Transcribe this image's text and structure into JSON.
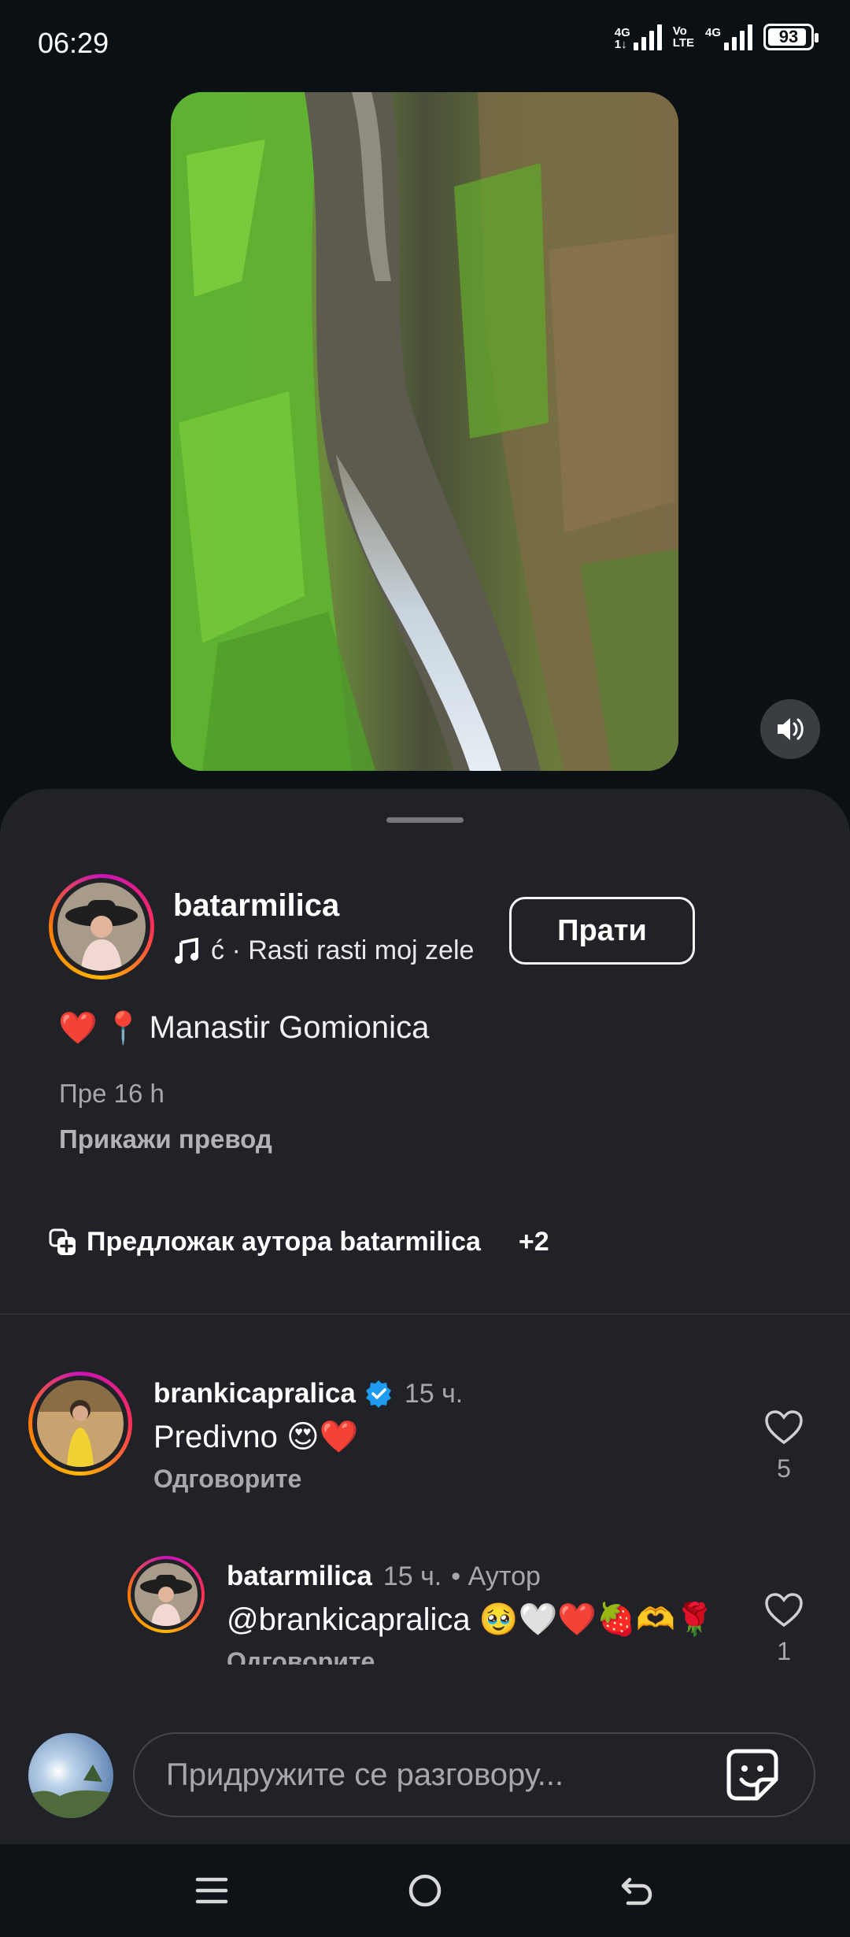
{
  "status_bar": {
    "time": "06:29",
    "net1_top": "4G",
    "net1_bottom": "1↓",
    "net2_top": "Vo",
    "net2_bottom": "LTE",
    "net3_top": "4G",
    "battery_percent": "93",
    "battery_level": 0.93
  },
  "reel": {
    "sound_icon": "speaker-icon"
  },
  "sheet": {
    "author": {
      "username": "batarmilica",
      "audio": "ć · Rasti rasti moj zele",
      "follow_label": "Прати"
    },
    "caption": {
      "heart": "❤️",
      "pin": "📍",
      "text": "Manastir Gomionica"
    },
    "time_ago": "Пре 16 h",
    "translate_label": "Прикажи превод",
    "template": {
      "label": "Предложак аутора batarmilica",
      "plus": "+2"
    },
    "comments": [
      {
        "username": "brankicapralica",
        "verified": true,
        "time": "15 ч.",
        "text": "Predivno 😍❤️",
        "reply_label": "Одговорите",
        "likes": "5"
      },
      {
        "username": "batarmilica",
        "time": "15 ч.",
        "author_tag": "• Аутор",
        "text": "@brankicapralica 🥹🤍❤️🍓🫶🌹",
        "reply_label": "Одговорите",
        "likes": "1"
      }
    ]
  },
  "composer": {
    "placeholder": "Придружите се разговору..."
  },
  "colors": {
    "background": "#0b1014",
    "sheet": "#212227",
    "verified": "#1d9bf0",
    "story_ring": "#c913b9"
  }
}
